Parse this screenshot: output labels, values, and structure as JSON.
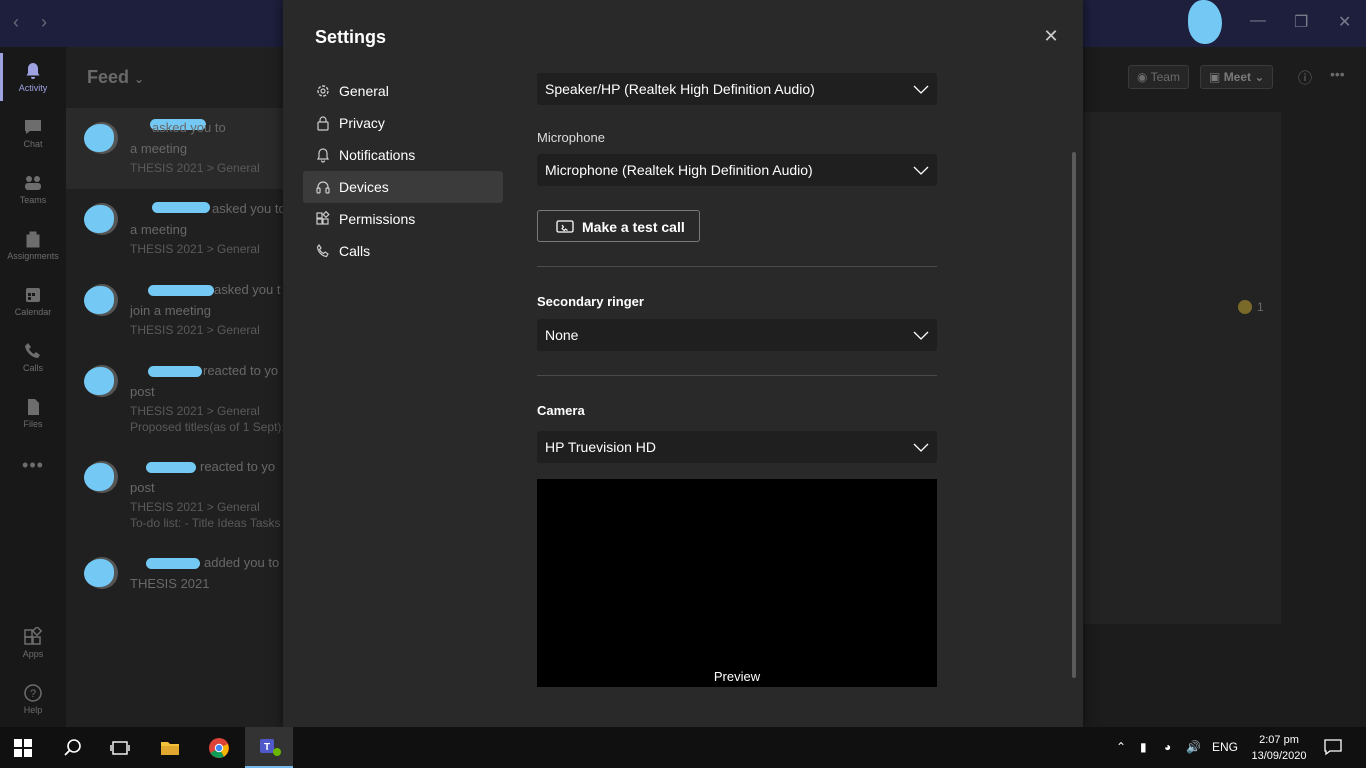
{
  "rail": {
    "items": [
      {
        "label": "Activity",
        "icon": "bell-icon"
      },
      {
        "label": "Chat",
        "icon": "chat-icon"
      },
      {
        "label": "Teams",
        "icon": "teams-icon"
      },
      {
        "label": "Assignments",
        "icon": "assignments-icon"
      },
      {
        "label": "Calendar",
        "icon": "calendar-icon"
      },
      {
        "label": "Calls",
        "icon": "phone-icon"
      },
      {
        "label": "Files",
        "icon": "file-icon"
      },
      {
        "label": "Apps",
        "icon": "apps-icon"
      },
      {
        "label": "Help",
        "icon": "help-icon"
      }
    ]
  },
  "feed": {
    "title": "Feed",
    "items": [
      {
        "line1": "asked you to",
        "line2": "a meeting",
        "line3": "THESIS 2021 > General"
      },
      {
        "line1": "asked you to",
        "line2": "a meeting",
        "line3": "THESIS 2021 > General"
      },
      {
        "line1": "asked you t",
        "line2": "join a meeting",
        "line3": "THESIS 2021 > General"
      },
      {
        "line1": "reacted to yo",
        "line2": "post",
        "line3": "THESIS 2021 > General",
        "line4": "Proposed titles(as of 1 Sept):"
      },
      {
        "line1": "reacted to yo",
        "line2": "post",
        "line3": "THESIS 2021 > General",
        "line4": "To-do list: - Title Ideas Tasks"
      },
      {
        "line1": "added you to",
        "line2": "THESIS 2021"
      }
    ]
  },
  "right": {
    "team_label": "Team",
    "meet_label": "Meet",
    "reaction_count": "1"
  },
  "settings": {
    "title": "Settings",
    "nav": [
      {
        "label": "General",
        "icon": "gear-icon"
      },
      {
        "label": "Privacy",
        "icon": "lock-icon"
      },
      {
        "label": "Notifications",
        "icon": "bell-icon"
      },
      {
        "label": "Devices",
        "icon": "headset-icon"
      },
      {
        "label": "Permissions",
        "icon": "permissions-icon"
      },
      {
        "label": "Calls",
        "icon": "phone-icon"
      }
    ],
    "speaker_value": "Speaker/HP (Realtek High Definition Audio)",
    "microphone_label": "Microphone",
    "microphone_value": "Microphone (Realtek High Definition Audio)",
    "test_call_label": "Make a test call",
    "secondary_ringer_label": "Secondary ringer",
    "secondary_ringer_value": "None",
    "camera_label": "Camera",
    "camera_value": "HP Truevision HD",
    "preview_label": "Preview"
  },
  "taskbar": {
    "language": "ENG",
    "time": "2:07 pm",
    "date": "13/09/2020"
  },
  "colors": {
    "accent": "#9ea2e0",
    "redaction": "#74c9f4"
  }
}
